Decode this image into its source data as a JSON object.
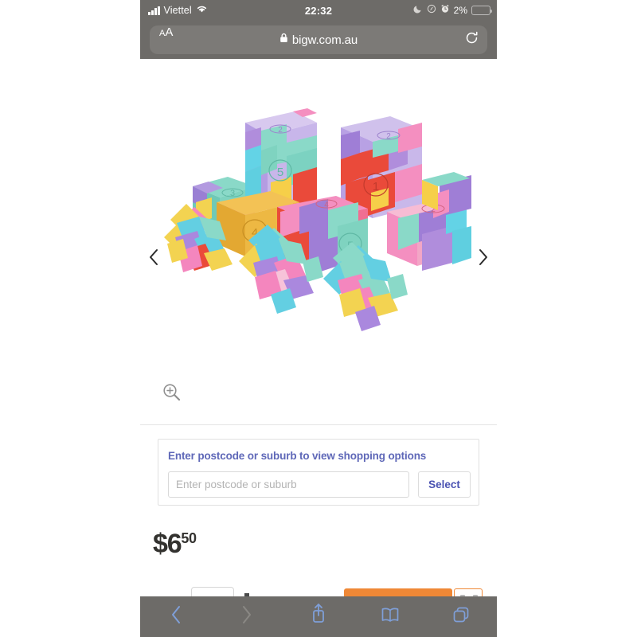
{
  "status_bar": {
    "carrier": "Viettel",
    "time": "22:32",
    "battery_percent": "2%",
    "icons": [
      "signal-bars-icon",
      "wifi-icon",
      "moon-dnd-icon",
      "location-icon",
      "alarm-clock-icon",
      "battery-icon"
    ],
    "battery_fill_color": "#e8952e",
    "bar_color": "#6d6b68"
  },
  "browser": {
    "text_size_label_small": "A",
    "text_size_label_large": "A",
    "lock_icon": "lock-icon",
    "url": "bigw.com.au",
    "reload_icon": "reload-icon",
    "bottom_toolbar": {
      "back_label": "back-chevron-icon",
      "forward_label": "forward-chevron-icon",
      "share_label": "share-icon",
      "bookmarks_label": "bookmarks-book-icon",
      "tabs_label": "tabs-icon",
      "back_enabled_color": "#7f9fd8",
      "forward_disabled_color": "#8a8884"
    }
  },
  "gallery": {
    "prev_arrow": "chevron-left-icon",
    "next_arrow": "chevron-right-icon",
    "zoom_icon": "magnifier-plus-icon",
    "product_alt": "Colourful puzzle cube and star erasers"
  },
  "postcode": {
    "heading": "Enter postcode or suburb to view shopping options",
    "input_placeholder": "Enter postcode or suburb",
    "input_value": "",
    "select_label": "Select",
    "accent_color": "#5f68b8"
  },
  "price": {
    "dollars": "$6",
    "cents": "50"
  },
  "cart_row": {
    "quantity_label": "quantity-selector",
    "add_to_cart_label": "add-to-cart-button",
    "wishlist_label": "wishlist-button",
    "accent_color": "#ef8836"
  }
}
